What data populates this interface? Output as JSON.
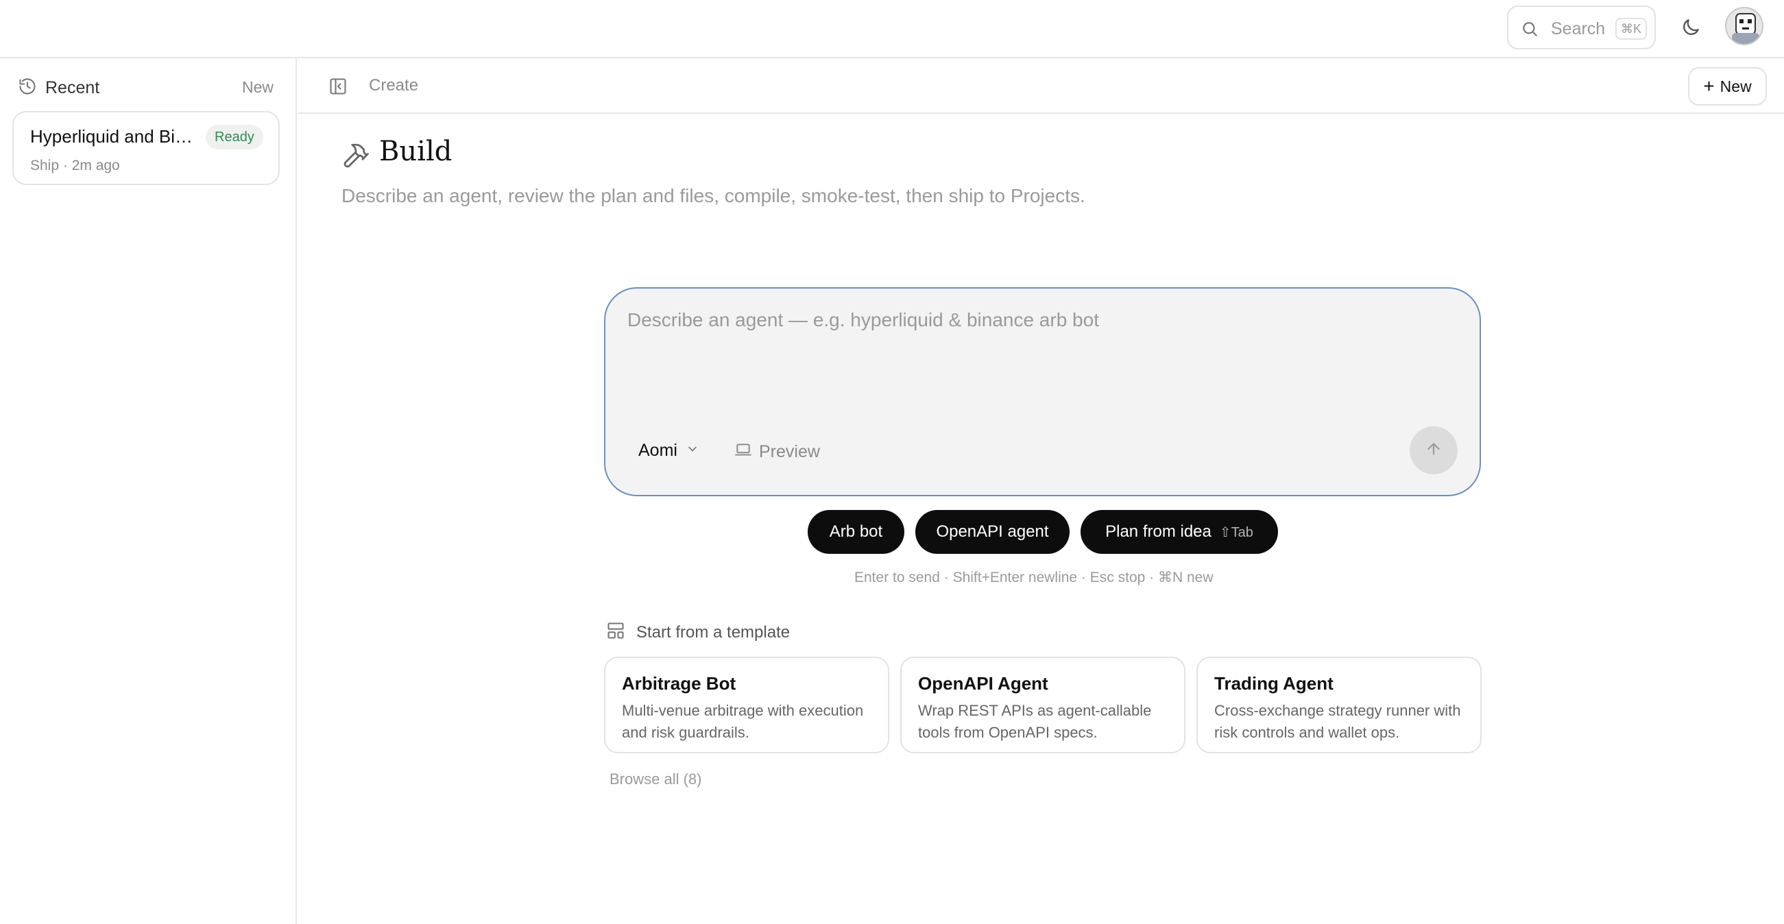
{
  "topbar": {
    "search_label": "Search",
    "search_shortcut": "⌘K",
    "theme_icon": "moon-icon",
    "avatar_icon": "avatar"
  },
  "sidebar": {
    "heading": "Recent",
    "new_label": "New",
    "recent": [
      {
        "name": "Hyperliquid and Binance",
        "status": "Ready",
        "meta": "Ship · 2m ago"
      }
    ]
  },
  "subheader": {
    "crumb": "Create",
    "new_label": "New"
  },
  "page": {
    "title": "Build",
    "subtitle": "Describe an agent, review the plan and files, compile, smoke-test, then ship to Projects."
  },
  "composer": {
    "placeholder": "Describe an agent — e.g. hyperliquid & binance arb bot",
    "value": "",
    "model": "Aomi",
    "preview_label": "Preview"
  },
  "chips": [
    {
      "label": "Arb bot"
    },
    {
      "label": "OpenAPI agent"
    },
    {
      "label": "Plan from idea",
      "shortcut": "⇧Tab"
    }
  ],
  "hint": "Enter to send · Shift+Enter newline · Esc stop · ⌘N new",
  "templates": {
    "heading": "Start from a template",
    "items": [
      {
        "title": "Arbitrage Bot",
        "description": "Multi-venue arbitrage with execution and risk guardrails."
      },
      {
        "title": "OpenAPI Agent",
        "description": "Wrap REST APIs as agent-callable tools from OpenAPI specs."
      },
      {
        "title": "Trading Agent",
        "description": "Cross-exchange strategy runner with risk controls and wallet ops."
      }
    ],
    "browse_all": "Browse all (8)"
  },
  "colors": {
    "accent_border": "#6b8fc0",
    "chip_bg": "#0d0d0d",
    "ready_badge": "#2e8b57"
  }
}
